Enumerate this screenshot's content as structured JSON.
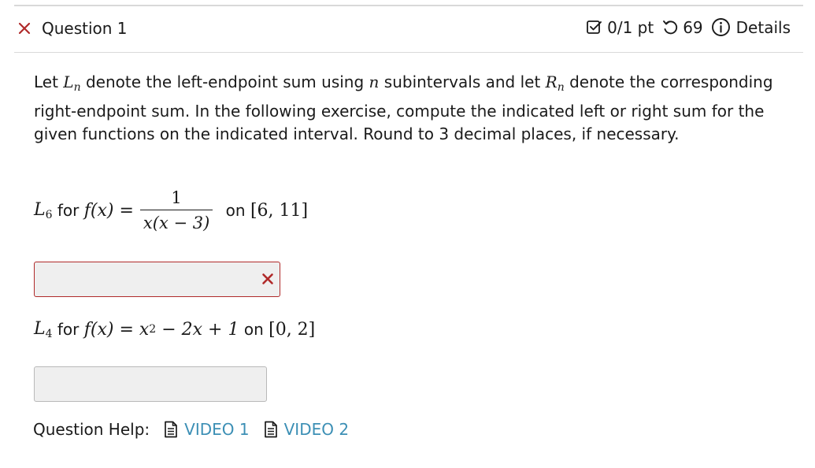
{
  "header": {
    "status_icon": "x-icon",
    "title": "Question 1",
    "score_icon": "checkbox-check-icon",
    "score": "0/1 pt",
    "attempts_icon": "undo-icon",
    "attempts": "69",
    "details_icon": "info-icon",
    "details_label": "Details"
  },
  "question": {
    "intro": {
      "t1": "Let ",
      "Ln_base": "L",
      "Ln_sub": "n",
      "t2": " denote the left-endpoint sum using ",
      "n_var": "n",
      "t3": " subintervals and let ",
      "Rn_base": "R",
      "Rn_sub": "n",
      "t4": " denote the corresponding right-endpoint sum. In the following exercise, compute the indicated left or right sum for the given functions on the indicated interval. Round to 3 decimal places, if necessary."
    },
    "part1": {
      "L_base": "L",
      "L_sub": "6",
      "for_word": " for ",
      "f_lhs": "f(x) =",
      "numerator": "1",
      "denominator": "x(x − 3)",
      "on_word": " on ",
      "interval": "[6, 11]",
      "answer_value": "",
      "answer_state": "incorrect",
      "answer_state_icon": "x-icon"
    },
    "part2": {
      "L_base": "L",
      "L_sub": "4",
      "for_word": " for ",
      "f_lhs": "f(x) = x",
      "exp": "2",
      "f_rest": " − 2x + 1",
      "on_word": " on ",
      "interval": "[0, 2]",
      "answer_value": ""
    }
  },
  "help": {
    "label": "Question Help:",
    "video_icon": "document-icon",
    "videos": [
      {
        "label": "VIDEO 1"
      },
      {
        "label": "VIDEO 2"
      }
    ]
  },
  "colors": {
    "wrong_red": "#b02a2a",
    "link_blue": "#3c8fb5",
    "input_bg": "#efefef"
  }
}
